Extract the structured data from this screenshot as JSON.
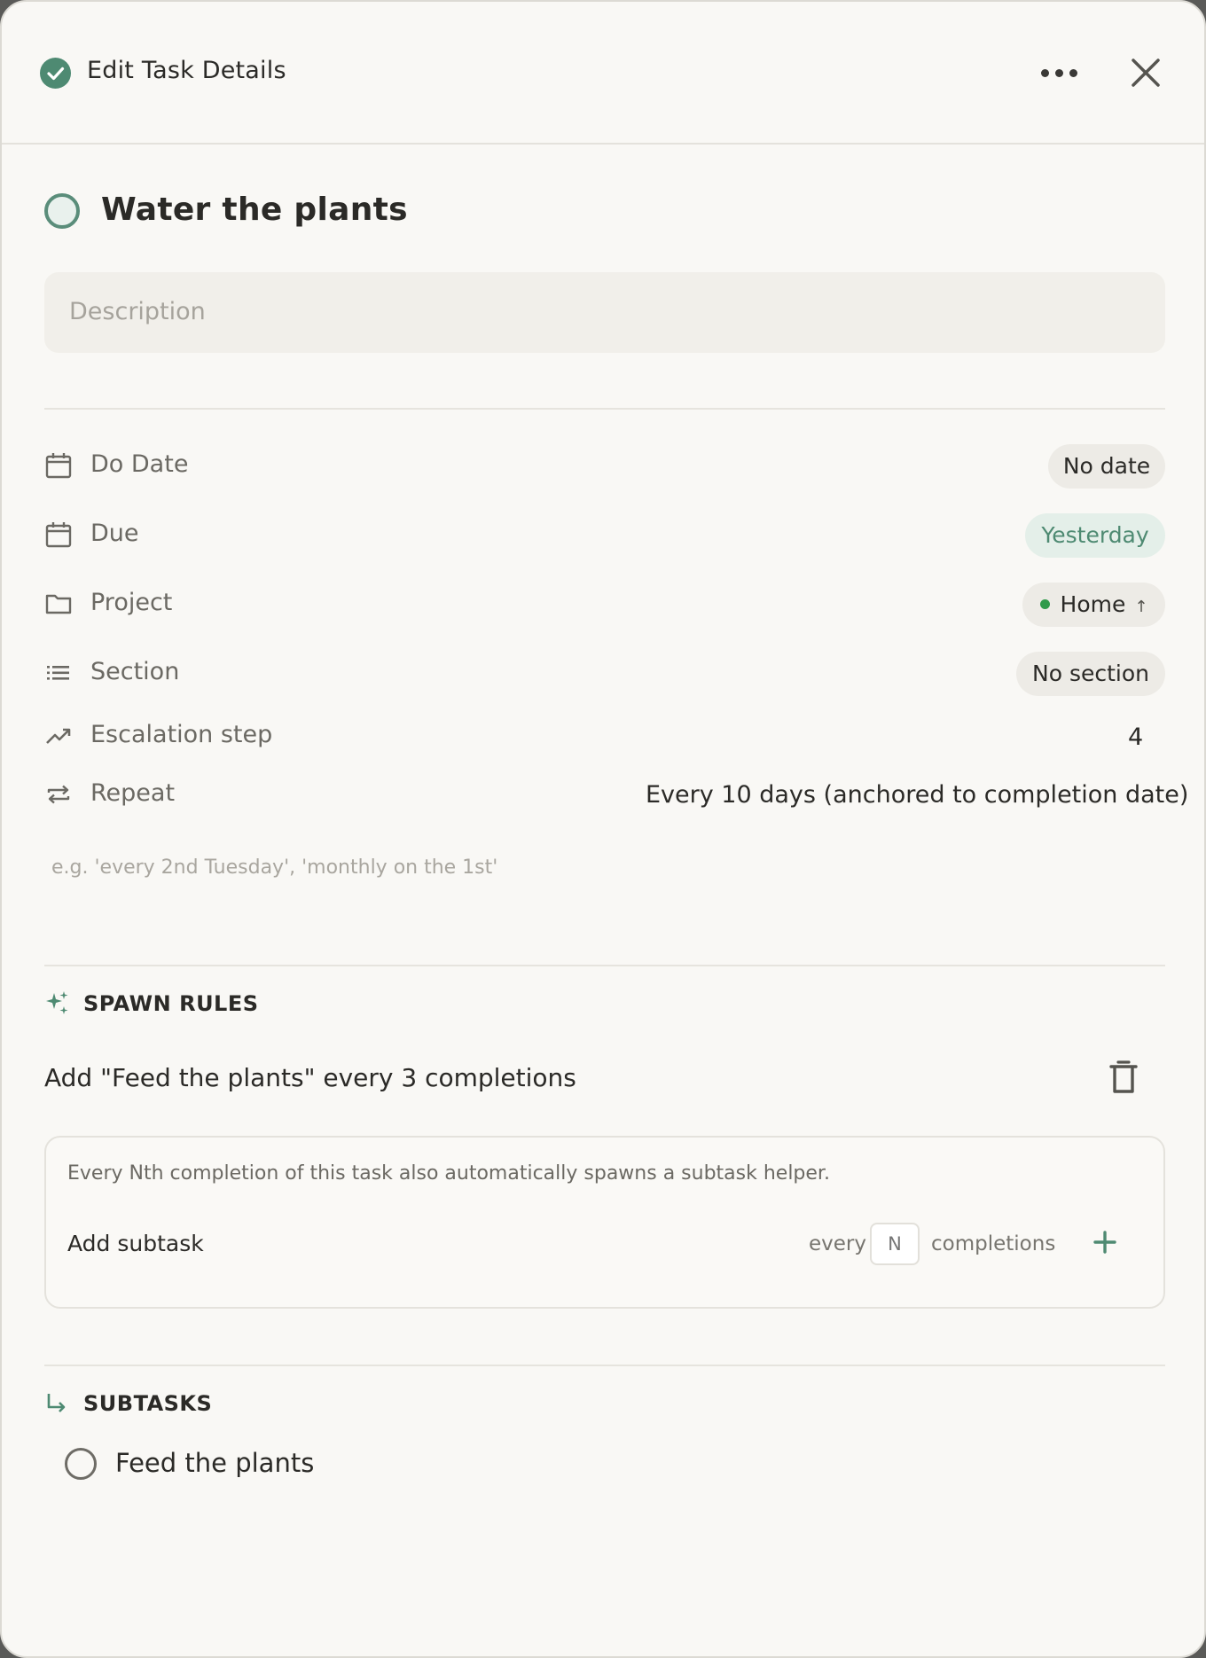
{
  "header": {
    "title": "Edit Task Details",
    "more_icon": "more-horizontal-icon",
    "close_icon": "close-icon"
  },
  "task": {
    "title": "Water the plants",
    "description_placeholder": "Description"
  },
  "properties": {
    "do_date": {
      "label": "Do Date",
      "value": "No date"
    },
    "due": {
      "label": "Due",
      "value": "Yesterday"
    },
    "project": {
      "label": "Project",
      "value": "Home",
      "arrow": "↑"
    },
    "section": {
      "label": "Section",
      "value": "No section"
    },
    "escalation": {
      "label": "Escalation step",
      "value": "4"
    },
    "repeat": {
      "label": "Repeat",
      "value": "Every 10 days (anchored to completion date)"
    }
  },
  "repeat_hint": "e.g. 'every 2nd Tuesday', 'monthly on the 1st'",
  "spawn_rules": {
    "heading": "SPAWN RULES",
    "rule_text": "Add \"Feed the plants\" every 3 completions",
    "help_text": "Every Nth completion of this task also automatically spawns a subtask helper.",
    "add_placeholder": "Add subtask",
    "every_label": "every",
    "n_placeholder": "N",
    "completions_label": "completions"
  },
  "subtasks": {
    "heading": "SUBTASKS",
    "items": [
      {
        "title": "Feed the plants"
      }
    ]
  },
  "colors": {
    "accent": "#4e8a72",
    "background": "#f9f8f5",
    "project_dot": "#2f9a4a"
  }
}
